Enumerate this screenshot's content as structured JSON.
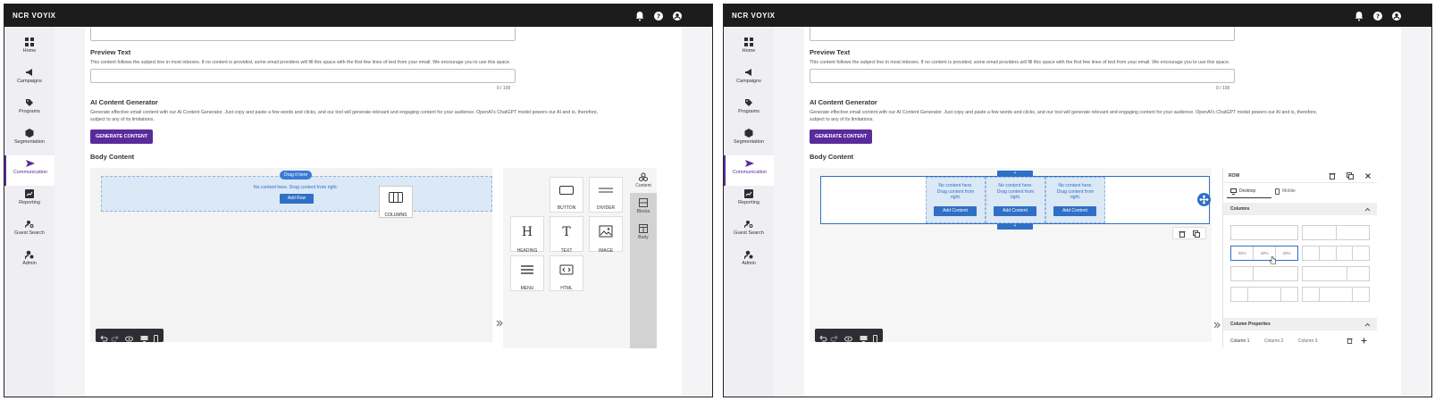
{
  "brand": "NCR VOYIX",
  "nav": [
    "Home",
    "Campaigns",
    "Programs",
    "Segmentation",
    "Communication",
    "Reporting",
    "Guest Search",
    "Admin"
  ],
  "preview": {
    "title": "Preview Text",
    "desc": "This content follows the subject line in most inboxes. If no content is provided, some email providers will fill this space with the first few lines of text from your email. We encourage you to use this space.",
    "counter": "0 / 100"
  },
  "ai": {
    "title": "AI Content Generator",
    "desc1": "Generate effective email content with our AI Content Generator. Just copy and paste a few words and clicks, and our tool will generate relevant and engaging content for your audience. OpenAI's ChatGPT model powers our AI and is, therefore,",
    "desc2": "subject to any of its limitations.",
    "button": "GENERATE CONTENT"
  },
  "body_title": "Body Content",
  "left": {
    "drag_pill": "Drag it here",
    "zone_text": "No content here. Drag content from right.",
    "add_row": "Add Row",
    "dragging_label": "COLUMNS",
    "blocks": [
      "BUTTON",
      "DIVIDER",
      "HEADING",
      "TEXT",
      "IMAGE",
      "MENU",
      "HTML"
    ],
    "tabs": [
      "Content",
      "Blocks",
      "Body"
    ]
  },
  "right": {
    "col_line1": "No content here.",
    "col_line2": "Drag content from",
    "col_line3": "right.",
    "add_content": "Add Content",
    "plus": "+",
    "panel_title": "ROW",
    "desktop": "Desktop",
    "mobile": "Mobile",
    "columns_section": "Columns",
    "pct": "33%",
    "col_props": "Column Properties",
    "col_tabs": [
      "Column 1",
      "Column 2",
      "Column 3"
    ]
  },
  "colors": {
    "accent": "#5b2a9c",
    "blue": "#2f6fc6",
    "topbar": "#1c1c1c"
  }
}
